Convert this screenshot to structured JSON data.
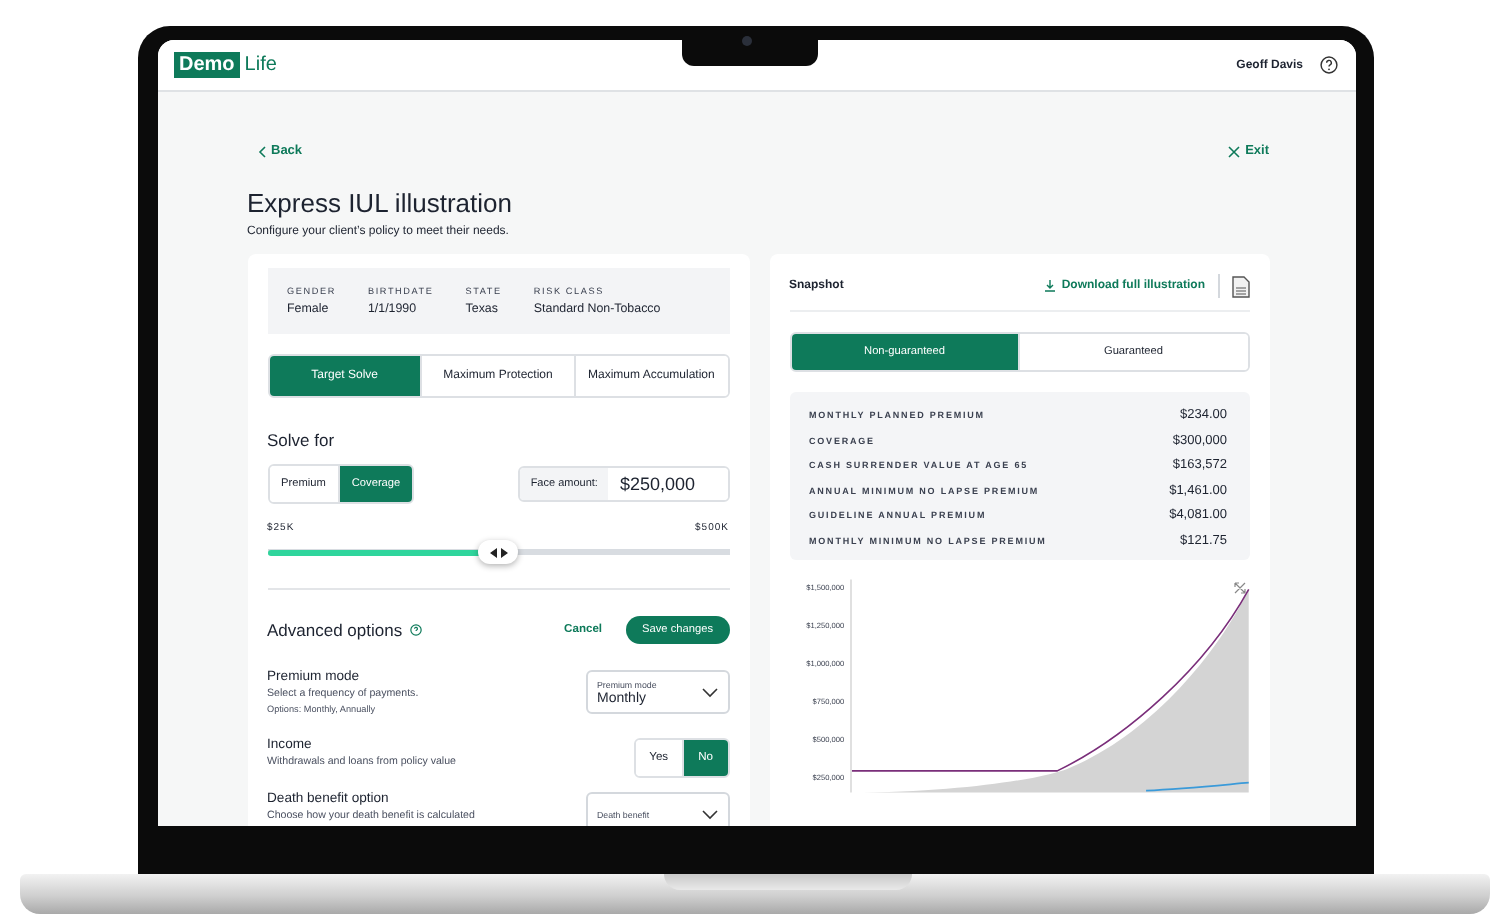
{
  "header": {
    "logo_word": "Demo",
    "logo_suffix": "Life",
    "user": "Geoff Davis"
  },
  "nav": {
    "back": "Back",
    "exit": "Exit"
  },
  "page": {
    "title": "Express IUL illustration",
    "subtitle": "Configure your client’s policy to meet their needs."
  },
  "client_info": [
    {
      "label": "GENDER",
      "value": "Female"
    },
    {
      "label": "BIRTHDATE",
      "value": "1/1/1990"
    },
    {
      "label": "STATE",
      "value": "Texas"
    },
    {
      "label": "RISK CLASS",
      "value": "Standard Non-Tobacco"
    }
  ],
  "solve_tabs": [
    {
      "label": "Target Solve",
      "selected": true
    },
    {
      "label": "Maximum Protection",
      "selected": false
    },
    {
      "label": "Maximum Accumulation",
      "selected": false
    }
  ],
  "solve_for": {
    "heading": "Solve for",
    "options": [
      {
        "label": "Premium",
        "selected": false
      },
      {
        "label": "Coverage",
        "selected": true
      }
    ],
    "face_amount_label": "Face amount:",
    "face_amount_value": "$250,000"
  },
  "slider": {
    "min_label": "$25K",
    "max_label": "$500K",
    "level": 0.5
  },
  "advanced": {
    "heading": "Advanced options",
    "cancel": "Cancel",
    "save": "Save changes",
    "options": [
      {
        "kind": "dropdown",
        "title": "Premium mode",
        "description": "Select a frequency of payments.",
        "note": "Options: Monthly, Annually",
        "field_label": "Premium mode",
        "value": "Monthly"
      },
      {
        "kind": "toggle",
        "title": "Income",
        "description": "Withdrawals and loans from policy value",
        "choices": [
          {
            "label": "Yes",
            "selected": false
          },
          {
            "label": "No",
            "selected": true
          }
        ]
      },
      {
        "kind": "dropdown",
        "title": "Death benefit option",
        "description": "Choose how your death benefit is calculated",
        "field_label": "Death benefit"
      }
    ]
  },
  "snapshot": {
    "title": "Snapshot",
    "download": "Download full illustration",
    "views": [
      {
        "label": "Non-guaranteed",
        "selected": true
      },
      {
        "label": "Guaranteed",
        "selected": false
      }
    ],
    "rows": [
      {
        "label": "MONTHLY PLANNED PREMIUM",
        "value": "$234.00"
      },
      {
        "label": "COVERAGE",
        "value": "$300,000"
      },
      {
        "label": "CASH SURRENDER VALUE AT AGE 65",
        "value": "$163,572"
      },
      {
        "label": "ANNUAL MINIMUM NO LAPSE PREMIUM",
        "value": "$1,461.00"
      },
      {
        "label": "GUIDELINE ANNUAL PREMIUM",
        "value": "$4,081.00"
      },
      {
        "label": "MONTHLY MINIMUM NO LAPSE PREMIUM",
        "value": "$121.75"
      }
    ],
    "chart": {
      "y_labels": [
        "$1,500,000",
        "$1,250,000",
        "$1,000,000",
        "$750,000",
        "$500,000",
        "$250,000"
      ]
    }
  }
}
